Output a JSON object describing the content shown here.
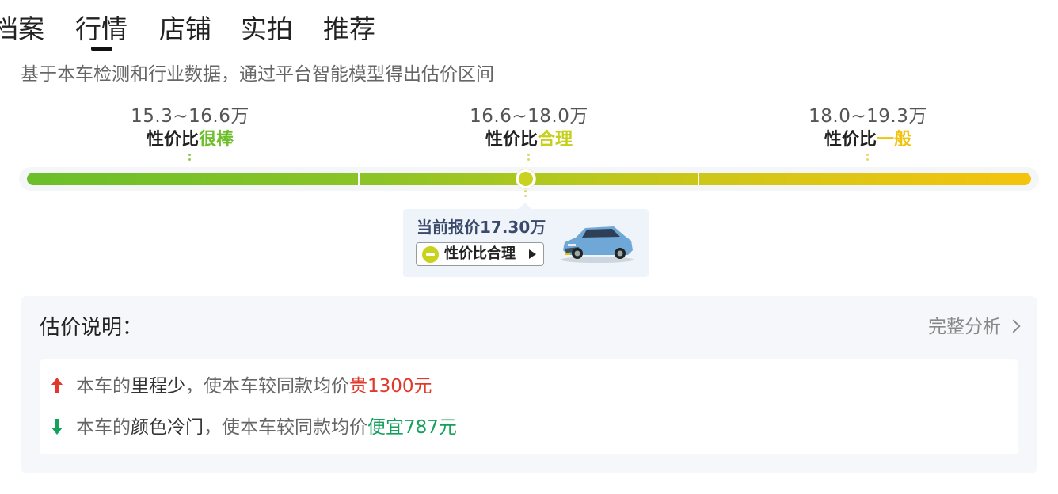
{
  "tabs": [
    {
      "label": "档案"
    },
    {
      "label": "行情",
      "active": true
    },
    {
      "label": "店铺"
    },
    {
      "label": "实拍"
    },
    {
      "label": "推荐"
    }
  ],
  "intro": "基于本车检测和行业数据，通过平台智能模型得出估价区间",
  "ranges": [
    {
      "value": "15.3~16.6万",
      "prefix": "性价比",
      "rating": "很棒",
      "color": "#6dbf2a"
    },
    {
      "value": "16.6~18.0万",
      "prefix": "性价比",
      "rating": "合理",
      "color": "#c5cf1c"
    },
    {
      "value": "18.0~19.3万",
      "prefix": "性价比",
      "rating": "一般",
      "color": "#f2c30e"
    }
  ],
  "current": {
    "price_label": "当前报价17.30万",
    "pill_label": "性价比合理",
    "price_value_wan": 17.3
  },
  "explanation": {
    "title": "估价说明：",
    "link": "完整分析",
    "items": [
      {
        "pre": "本车的",
        "factor": "里程少",
        "mid": "，使本车较同款均价",
        "effect": "贵1300元",
        "direction": "up"
      },
      {
        "pre": "本车的",
        "factor": "颜色冷门",
        "mid": "，使本车较同款均价",
        "effect": "便宜787元",
        "direction": "down"
      }
    ]
  },
  "colors": {
    "up": "#e0382b",
    "down": "#15a05c",
    "good": "#6dbf2a",
    "fair": "#c5cf1c",
    "average": "#f2c30e"
  },
  "icons": [
    "current-marker-icon",
    "neutral-face-icon",
    "play-triangle-icon",
    "car-thumbnail",
    "chevron-right-icon",
    "arrow-up-icon",
    "arrow-down-icon"
  ]
}
